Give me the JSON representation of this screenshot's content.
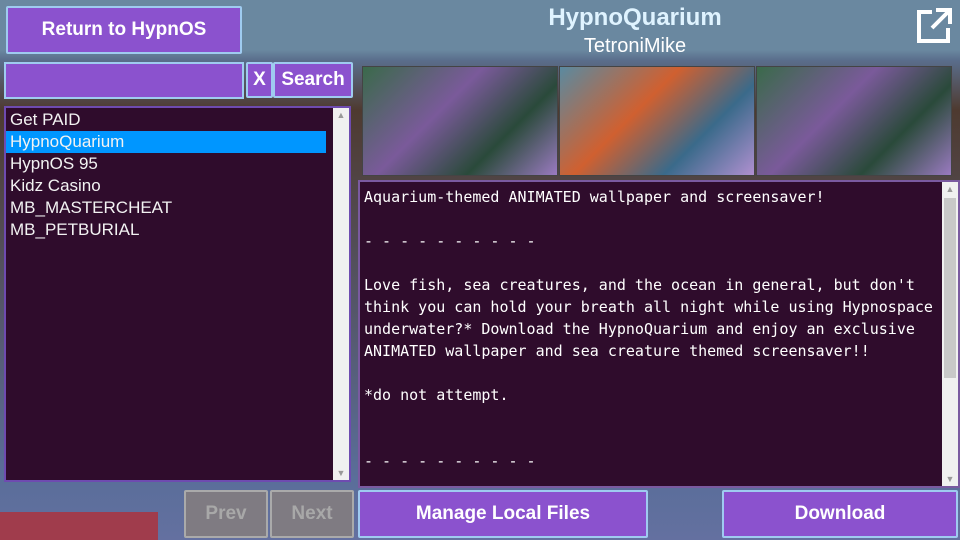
{
  "header": {
    "return_label": "Return to HypnOS",
    "title": "HypnoQuarium",
    "author": "TetroniMike",
    "popout_icon": "external-link-icon"
  },
  "search": {
    "value": "",
    "clear_label": "X",
    "search_label": "Search"
  },
  "list": {
    "items": [
      "Get PAID",
      "HypnoQuarium",
      "HypnOS 95",
      "Kidz Casino",
      "MB_MASTERCHEAT",
      "MB_PETBURIAL"
    ],
    "selected": "HypnoQuarium"
  },
  "pager": {
    "prev_label": "Prev",
    "next_label": "Next"
  },
  "description": "Aquarium-themed ANIMATED wallpaper and screensaver!\n\n- - - - - - - - - -\n\nLove fish, sea creatures, and the ocean in general, but don't think you can hold your breath all night while using Hypnospace underwater?* Download the HypnoQuarium and enjoy an exclusive ANIMATED wallpaper and sea creature themed screensaver!!\n\n*do not attempt.\n\n\n- - - - - - - - - -",
  "actions": {
    "manage_label": "Manage Local Files",
    "download_label": "Download"
  }
}
